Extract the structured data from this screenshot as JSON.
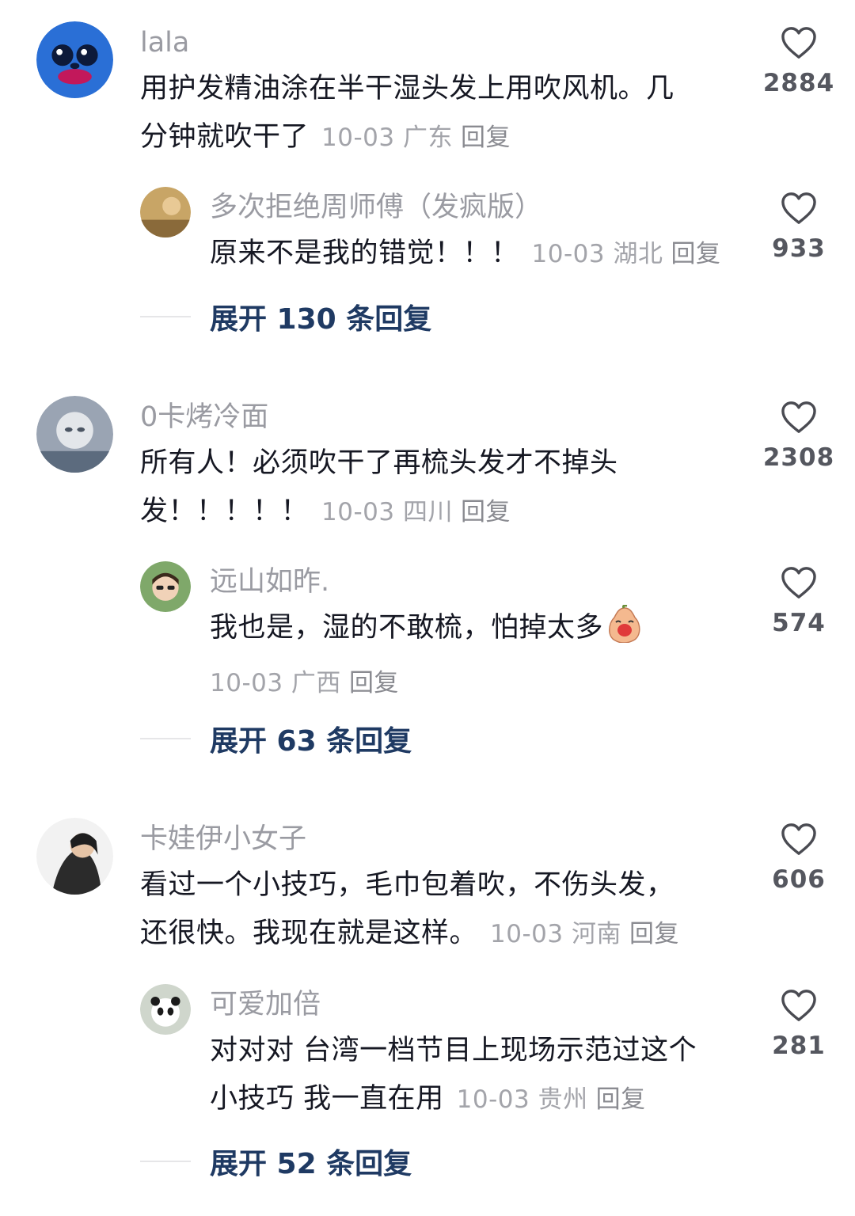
{
  "comments": [
    {
      "username": "lala",
      "text_lines": [
        "用护发精油涂在半干湿头发上用吹风机。几",
        "分钟就吹干了"
      ],
      "meta": "10-03 广东",
      "reply": "回复",
      "likes": "2884",
      "sub": {
        "username": "多次拒绝周师傅（发疯版）",
        "text_lines": [
          "原来不是我的错觉！！！"
        ],
        "meta": "10-03 湖北",
        "reply": "回复",
        "likes": "933"
      },
      "expand": "展开 130 条回复"
    },
    {
      "username": "0卡烤冷面",
      "text_lines": [
        "所有人！必须吹干了再梳头发才不掉头",
        "发！！！！！"
      ],
      "meta": "10-03 四川",
      "reply": "回复",
      "likes": "2308",
      "sub": {
        "username": "远山如昨.",
        "text_lines": [
          "我也是，湿的不敢梳，怕掉太多",
          ""
        ],
        "meta": "10-03 广西",
        "reply": "回复",
        "likes": "574"
      },
      "expand": "展开 63 条回复"
    },
    {
      "username": "卡娃伊小女子",
      "text_lines": [
        "看过一个小技巧，毛巾包着吹，不伤头发，",
        "还很快。我现在就是这样。"
      ],
      "meta": "10-03 河南",
      "reply": "回复",
      "likes": "606",
      "sub": {
        "username": "可爱加倍",
        "text_lines": [
          "对对对 台湾一档节目上现场示范过这个",
          "小技巧 我一直在用"
        ],
        "meta": "10-03 贵州",
        "reply": "回复",
        "likes": "281"
      },
      "expand": "展开 52 条回复"
    }
  ],
  "icons": {
    "like": "heart-outline-icon",
    "emoji": "crying-pear-emoji-icon"
  }
}
